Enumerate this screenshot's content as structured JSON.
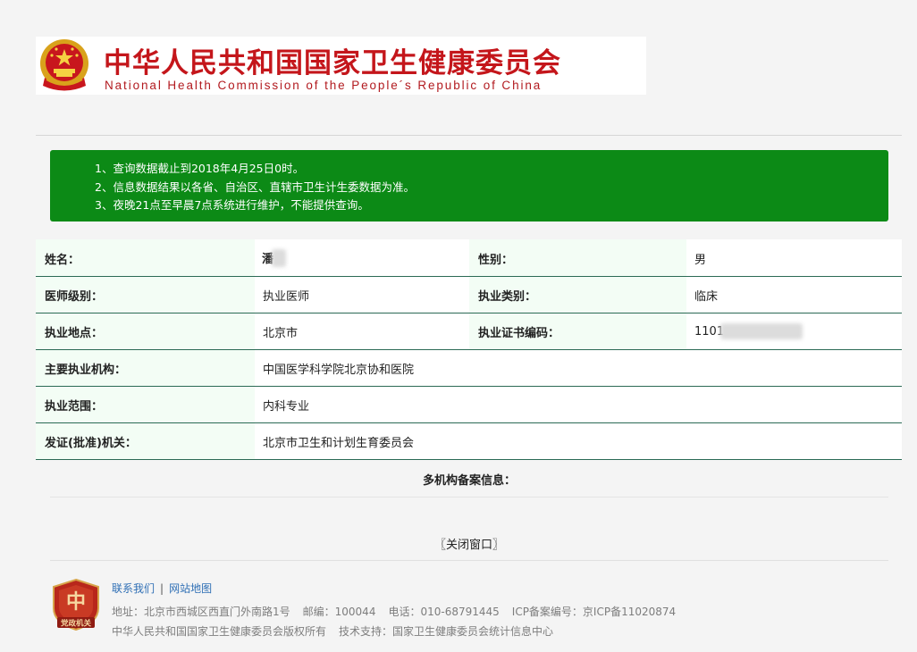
{
  "header": {
    "title_cn": "中华人民共和国国家卫生健康委员会",
    "title_en": "National Health Commission of the People´s Republic of China"
  },
  "notice": {
    "lines": [
      "1、查询数据截止到2018年4月25日0时。",
      "2、信息数据结果以各省、自治区、直辖市卫生计生委数据为准。",
      "3、夜晚21点至早晨7点系统进行维护，不能提供查询。"
    ]
  },
  "record": {
    "name_label": "姓名：",
    "name_value": "潘",
    "gender_label": "性别：",
    "gender_value": "男",
    "level_label": "医师级别：",
    "level_value": "执业医师",
    "category_label": "执业类别：",
    "category_value": "临床",
    "location_label": "执业地点：",
    "location_value": "北京市",
    "cert_label": "执业证书编码：",
    "cert_value": "1101",
    "institution_label": "主要执业机构：",
    "institution_value": "中国医学科学院北京协和医院",
    "scope_label": "执业范围：",
    "scope_value": "内科专业",
    "authority_label": "发证(批准)机关：",
    "authority_value": "北京市卫生和计划生育委员会"
  },
  "multi_label": "多机构备案信息：",
  "close_label": "〖关闭窗口〗",
  "footer": {
    "contact_link": "联系我们",
    "separator": "|",
    "sitemap_link": "网站地图",
    "address": "地址：北京市西城区西直门外南路1号",
    "postcode": "邮编：100044",
    "phone": "电话：010-68791445",
    "icp": "ICP备案编号：京ICP备11020874",
    "copyright": "中华人民共和国国家卫生健康委员会版权所有",
    "support": "技术支持：国家卫生健康委员会统计信息中心",
    "badge_text": "党政机关"
  },
  "colors": {
    "brand_red": "#c4161b",
    "notice_green": "#0c8a16",
    "row_border": "#2b6a55",
    "label_bg": "#f3fdf5",
    "link_blue": "#2f6fb5"
  }
}
